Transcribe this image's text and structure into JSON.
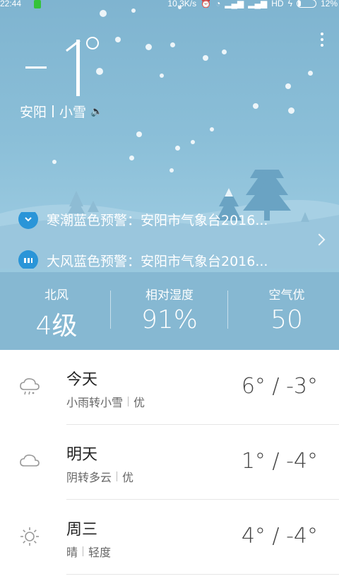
{
  "status_bar": {
    "time": "22:44",
    "network_speed": "10.3K/s",
    "network_type": "HD",
    "battery": "12%"
  },
  "current": {
    "temperature": "-1°",
    "city": "安阳",
    "condition": "小雪"
  },
  "alerts": [
    {
      "text": "寒潮蓝色预警：安阳市气象台2016..."
    },
    {
      "text": "大风蓝色预警：安阳市气象台2016..."
    }
  ],
  "metrics": [
    {
      "label": "北风",
      "value": "4级"
    },
    {
      "label": "相对湿度",
      "value": "91%"
    },
    {
      "label": "空气优",
      "value": "50"
    }
  ],
  "forecast": [
    {
      "day": "今天",
      "condition": "小雨转小雪",
      "air": "优",
      "range": "6° / -3°",
      "icon": "rain-snow-icon"
    },
    {
      "day": "明天",
      "condition": "阴转多云",
      "air": "优",
      "range": "1° / -4°",
      "icon": "cloud-icon"
    },
    {
      "day": "周三",
      "condition": "晴",
      "air": "轻度",
      "range": "4° / -4°",
      "icon": "sun-icon"
    }
  ],
  "colors": {
    "sky": "#8bbfd8",
    "alert_icon": "#2a95d8",
    "text_dark": "#222222"
  }
}
